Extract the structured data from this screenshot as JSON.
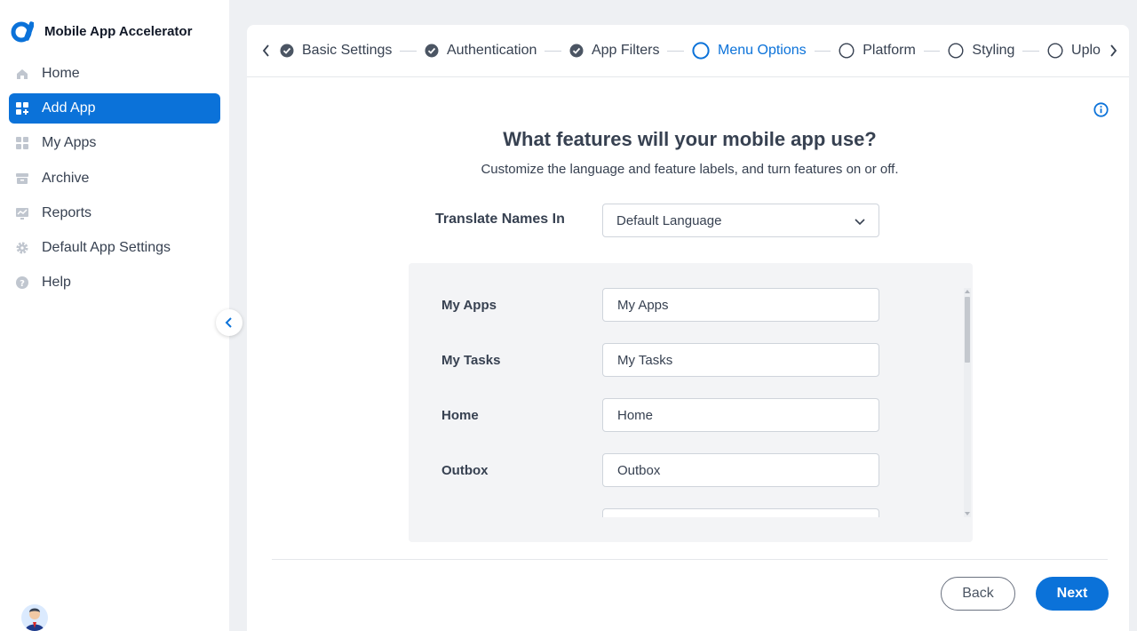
{
  "app": {
    "title": "Mobile App Accelerator",
    "accent_color": "#0b72d9"
  },
  "sidebar": {
    "items": [
      {
        "label": "Home",
        "icon": "home-icon",
        "active": false
      },
      {
        "label": "Add App",
        "icon": "add-app-grid-icon",
        "active": true
      },
      {
        "label": "My Apps",
        "icon": "apps-grid-icon",
        "active": false
      },
      {
        "label": "Archive",
        "icon": "archive-icon",
        "active": false
      },
      {
        "label": "Reports",
        "icon": "chart-icon",
        "active": false
      },
      {
        "label": "Default App Settings",
        "icon": "gear-icon",
        "active": false
      },
      {
        "label": "Help",
        "icon": "help-icon",
        "active": false
      }
    ],
    "collapse_icon": "chevron-left-icon"
  },
  "stepper": {
    "steps": [
      {
        "label": "Basic Settings",
        "state": "complete"
      },
      {
        "label": "Authentication",
        "state": "complete"
      },
      {
        "label": "App Filters",
        "state": "complete"
      },
      {
        "label": "Menu Options",
        "state": "current"
      },
      {
        "label": "Platform",
        "state": "pending"
      },
      {
        "label": "Styling",
        "state": "pending"
      },
      {
        "label": "Uplo",
        "state": "pending"
      }
    ]
  },
  "main": {
    "heading": "What features will your mobile app use?",
    "subheading": "Customize the language and feature labels, and turn features on or off.",
    "translate_label": "Translate Names In",
    "language_select": "Default Language",
    "features": [
      {
        "name": "My Apps",
        "value": "My Apps"
      },
      {
        "name": "My Tasks",
        "value": "My Tasks"
      },
      {
        "name": "Home",
        "value": "Home"
      },
      {
        "name": "Outbox",
        "value": "Outbox"
      },
      {
        "name": "",
        "value": ""
      }
    ]
  },
  "footer": {
    "back_label": "Back",
    "next_label": "Next"
  }
}
